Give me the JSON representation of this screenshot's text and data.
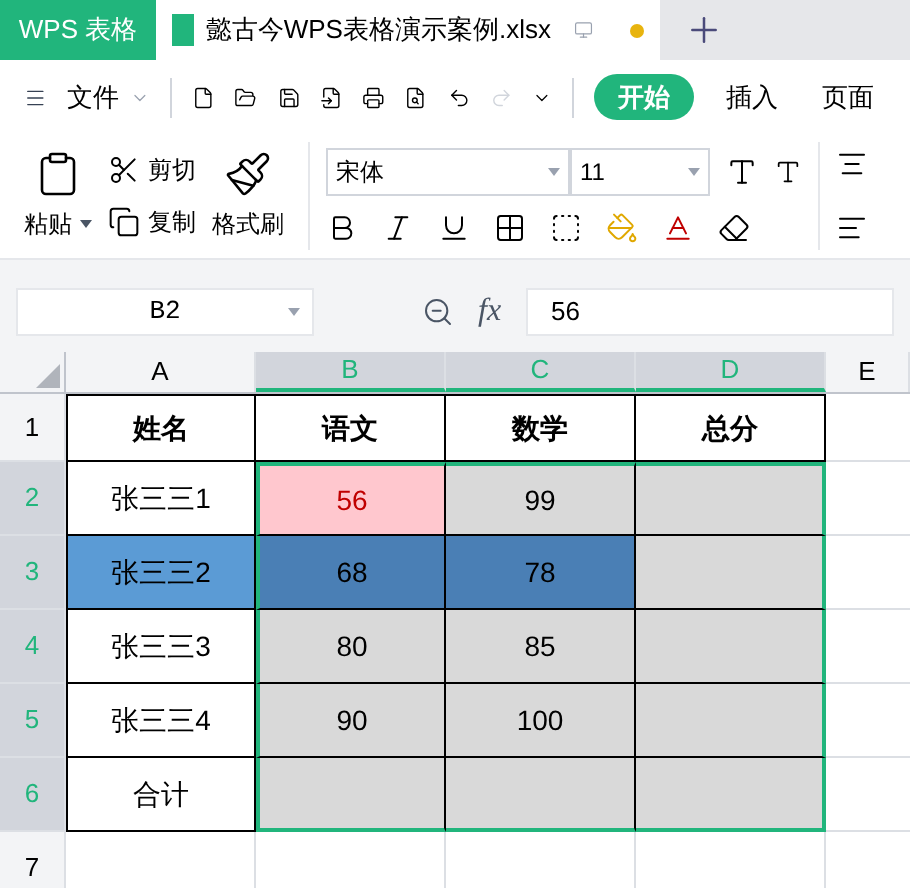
{
  "app_tab": {
    "label": "WPS 表格"
  },
  "doc_tabs": [
    {
      "label": "懿古今WPS表格演示案例.xlsx",
      "selected": true,
      "unsaved": true
    }
  ],
  "menu": {
    "file_label": "文件",
    "tabs": [
      {
        "label": "开始",
        "selected": true
      },
      {
        "label": "插入",
        "selected": false
      },
      {
        "label": "页面",
        "selected": false
      }
    ]
  },
  "ribbon": {
    "paste": "粘贴",
    "cut": "剪切",
    "copy": "复制",
    "format_painter": "格式刷",
    "font": "宋体",
    "font_size": "11"
  },
  "formula_bar": {
    "name_box": "B2",
    "fx": "fx",
    "value": "56"
  },
  "columns": [
    {
      "label": "A",
      "selected": false
    },
    {
      "label": "B",
      "selected": true
    },
    {
      "label": "C",
      "selected": true
    },
    {
      "label": "D",
      "selected": true
    },
    {
      "label": "E",
      "selected": false
    }
  ],
  "rows": [
    {
      "label": "1",
      "selected": false,
      "cells": [
        {
          "text": "姓名",
          "kind": "header"
        },
        {
          "text": "语文",
          "kind": "header"
        },
        {
          "text": "数学",
          "kind": "header"
        },
        {
          "text": "总分",
          "kind": "header"
        }
      ]
    },
    {
      "label": "2",
      "selected": true,
      "cells": [
        {
          "text": "张三三1",
          "kind": "plain"
        },
        {
          "text": "56",
          "kind": "alert"
        },
        {
          "text": "99",
          "kind": "shaded"
        },
        {
          "text": "",
          "kind": "shaded"
        }
      ]
    },
    {
      "label": "3",
      "selected": true,
      "cells": [
        {
          "text": "张三三2",
          "kind": "highlight"
        },
        {
          "text": "68",
          "kind": "highlight-dark"
        },
        {
          "text": "78",
          "kind": "highlight-dark"
        },
        {
          "text": "",
          "kind": "shaded"
        }
      ]
    },
    {
      "label": "4",
      "selected": true,
      "cells": [
        {
          "text": "张三三3",
          "kind": "plain"
        },
        {
          "text": "80",
          "kind": "shaded"
        },
        {
          "text": "85",
          "kind": "shaded"
        },
        {
          "text": "",
          "kind": "shaded"
        }
      ]
    },
    {
      "label": "5",
      "selected": true,
      "cells": [
        {
          "text": "张三三4",
          "kind": "plain"
        },
        {
          "text": "90",
          "kind": "shaded"
        },
        {
          "text": "100",
          "kind": "shaded"
        },
        {
          "text": "",
          "kind": "shaded"
        }
      ]
    },
    {
      "label": "6",
      "selected": true,
      "cells": [
        {
          "text": "合计",
          "kind": "plain"
        },
        {
          "text": "",
          "kind": "shaded"
        },
        {
          "text": "",
          "kind": "shaded"
        },
        {
          "text": "",
          "kind": "shaded"
        }
      ]
    },
    {
      "label": "7",
      "selected": false,
      "cells": []
    }
  ]
}
